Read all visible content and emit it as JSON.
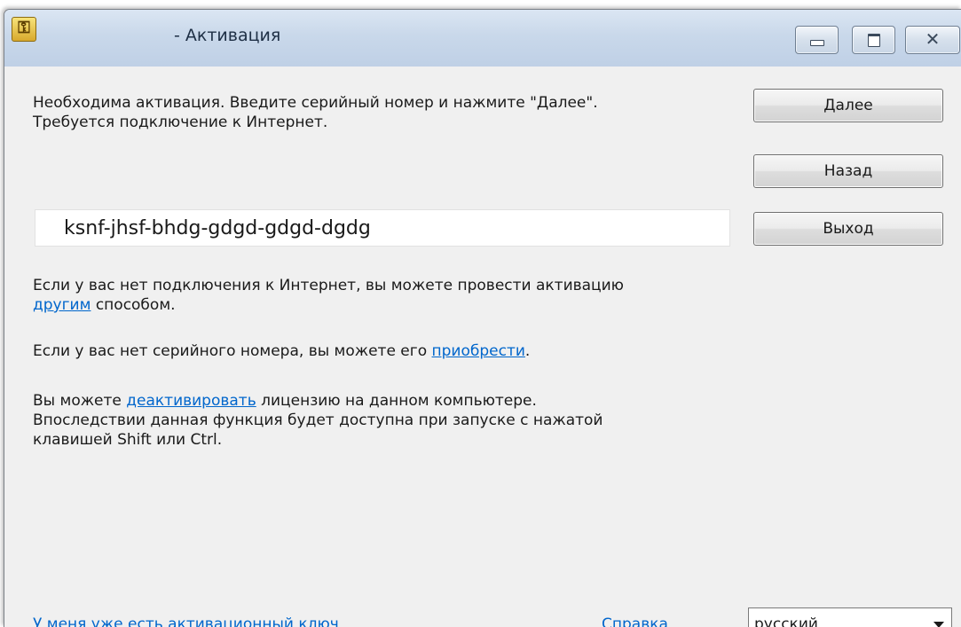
{
  "window": {
    "title": "- Активация",
    "icon": "key-document-icon",
    "controls": {
      "minimize": "minimize-icon",
      "maximize": "maximize-icon",
      "close": "close-icon"
    }
  },
  "main": {
    "intro_line1": "Необходима активация. Введите серийный номер и нажмите \"Далее\".",
    "intro_line2": "Требуется подключение к Интернет.",
    "serial_value": "ksnf-jhsf-bhdg-gdgd-gdgd-dgdg",
    "offline_line1": "Если у вас нет подключения к Интернет, вы можете провести активацию",
    "offline_link": "другим",
    "offline_after": " способом.",
    "buy_before": "Если у вас нет серийного номера, вы можете его ",
    "buy_link": "приобрести",
    "buy_after": ".",
    "deactivate_before": "Вы можете ",
    "deactivate_link": "деактивировать",
    "deactivate_after": " лицензию на данном компьютере.",
    "deactivate_line2": "Впоследствии данная функция будет доступна при запуске с нажатой",
    "deactivate_line3": "клавишей Shift или Ctrl."
  },
  "buttons": {
    "next": "Далее",
    "back": "Назад",
    "exit": "Выход"
  },
  "footer": {
    "have_key_link": "У меня уже есть активационный ключ",
    "help_link": "Справка",
    "language_selected": "русский"
  }
}
